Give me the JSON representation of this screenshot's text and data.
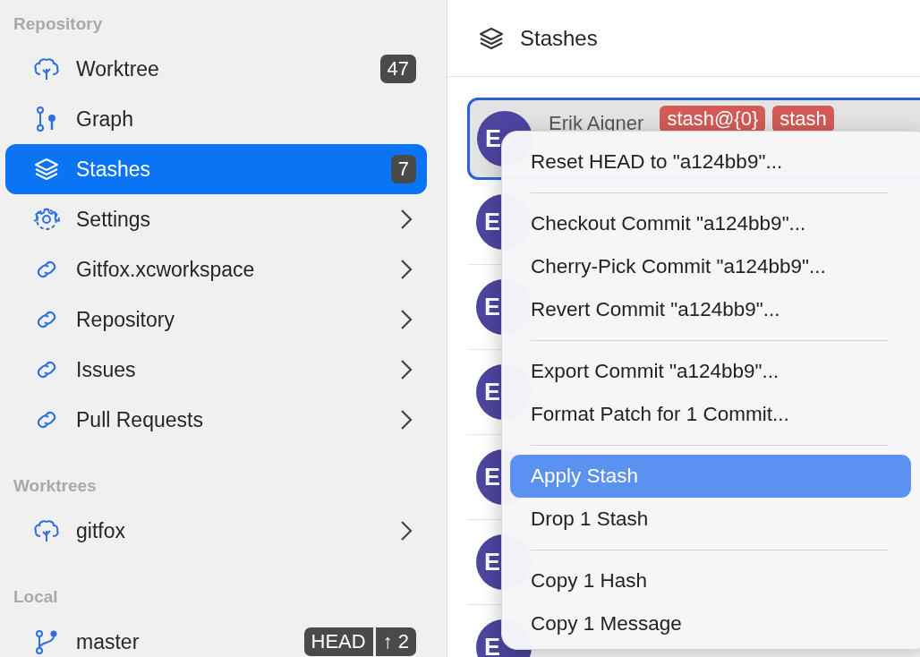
{
  "sidebar": {
    "sections": [
      {
        "title": "Repository",
        "items": [
          {
            "label": "Worktree",
            "kind": "tree",
            "badges": [
              "47"
            ],
            "expandable": false,
            "selected": false
          },
          {
            "label": "Graph",
            "kind": "graph",
            "expandable": false,
            "selected": false
          },
          {
            "label": "Stashes",
            "kind": "stack",
            "badges": [
              "7"
            ],
            "expandable": false,
            "selected": true
          },
          {
            "label": "Settings",
            "kind": "gear",
            "expandable": true,
            "selected": false
          },
          {
            "label": "Gitfox.xcworkspace",
            "kind": "link",
            "expandable": true,
            "selected": false
          },
          {
            "label": "Repository",
            "kind": "link",
            "expandable": true,
            "selected": false
          },
          {
            "label": "Issues",
            "kind": "link",
            "expandable": true,
            "selected": false
          },
          {
            "label": "Pull Requests",
            "kind": "link",
            "expandable": true,
            "selected": false
          }
        ]
      },
      {
        "title": "Worktrees",
        "items": [
          {
            "label": "gitfox",
            "kind": "tree",
            "expandable": true,
            "selected": false
          }
        ]
      },
      {
        "title": "Local",
        "items": [
          {
            "label": "master",
            "kind": "branch",
            "badges": [
              "HEAD",
              "↑ 2"
            ],
            "expandable": false,
            "selected": false
          }
        ]
      }
    ]
  },
  "header": {
    "title": "Stashes",
    "kind": "stack"
  },
  "stashes": [
    {
      "initials": "E",
      "author": "Erik Aigner",
      "tags": [
        "stash@{0}",
        "stash"
      ],
      "selected": true
    },
    {
      "initials": "E",
      "selected": false
    },
    {
      "initials": "E",
      "selected": false
    },
    {
      "initials": "E",
      "selected": false
    },
    {
      "initials": "E",
      "selected": false
    },
    {
      "initials": "E",
      "selected": false
    },
    {
      "initials": "E",
      "selected": false
    }
  ],
  "context_menu": [
    {
      "kind": "item",
      "label": "Reset HEAD to \"a124bb9\"...",
      "selected": false
    },
    {
      "kind": "separator"
    },
    {
      "kind": "item",
      "label": "Checkout Commit \"a124bb9\"...",
      "selected": false
    },
    {
      "kind": "item",
      "label": "Cherry-Pick Commit \"a124bb9\"...",
      "selected": false
    },
    {
      "kind": "item",
      "label": "Revert Commit \"a124bb9\"...",
      "selected": false
    },
    {
      "kind": "separator"
    },
    {
      "kind": "item",
      "label": "Export Commit \"a124bb9\"...",
      "selected": false
    },
    {
      "kind": "item",
      "label": "Format Patch for 1 Commit...",
      "selected": false
    },
    {
      "kind": "separator"
    },
    {
      "kind": "item",
      "label": "Apply Stash",
      "selected": true
    },
    {
      "kind": "item",
      "label": "Drop 1 Stash",
      "selected": false
    },
    {
      "kind": "separator"
    },
    {
      "kind": "item",
      "label": "Copy 1 Hash",
      "selected": false
    },
    {
      "kind": "item",
      "label": "Copy 1 Message",
      "selected": false
    }
  ]
}
